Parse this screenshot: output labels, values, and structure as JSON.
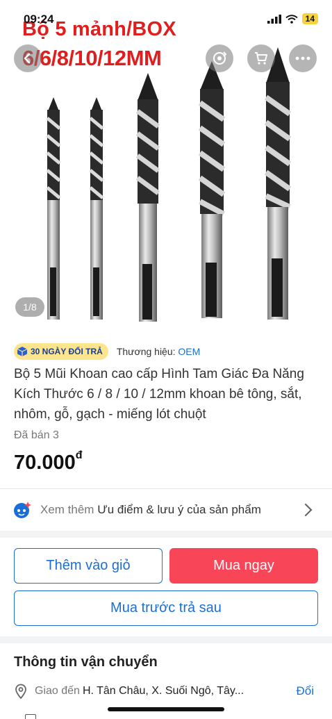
{
  "status_bar": {
    "time": "09:24",
    "battery": "14"
  },
  "hero": {
    "overlay_title": "Bộ 5 mảnh/BOX",
    "overlay_sub": "6/6/8/10/12MM",
    "image_counter": "1/8",
    "icons": [
      "back-icon",
      "reload-share-icon",
      "cart-icon",
      "more-icon"
    ]
  },
  "product": {
    "return_badge": "30 NGÀY ĐỔI TRẢ",
    "brand_label": "Thương hiệu: ",
    "brand_value": "OEM",
    "title": "Bộ 5 Mũi Khoan cao cấp Hình Tam Giác Đa Năng Kích Thước 6 / 8 / 10 / 12mm khoan bê tông, sắt, nhôm, gỗ, gạch - miếng lót chuột",
    "sold": "Đã bán 3",
    "price": "70.000",
    "currency": "đ"
  },
  "see_more": {
    "prefix": "Xem thêm ",
    "text": "Ưu điểm & lưu ý của sản phẩm"
  },
  "actions": {
    "add_to_cart": "Thêm vào giỏ",
    "buy_now": "Mua ngay",
    "bnpl": "Mua trước trả sau"
  },
  "shipping": {
    "title": "Thông tin vận chuyển",
    "deliver_label": "Giao đến",
    "address": "H. Tân Châu, X. Suối Ngô, Tây...",
    "change": "Đổi"
  },
  "colors": {
    "accent": "#1a6fd6",
    "buy": "#f84557",
    "overlay_text": "#e01e1e",
    "badge": "#fde58f"
  }
}
